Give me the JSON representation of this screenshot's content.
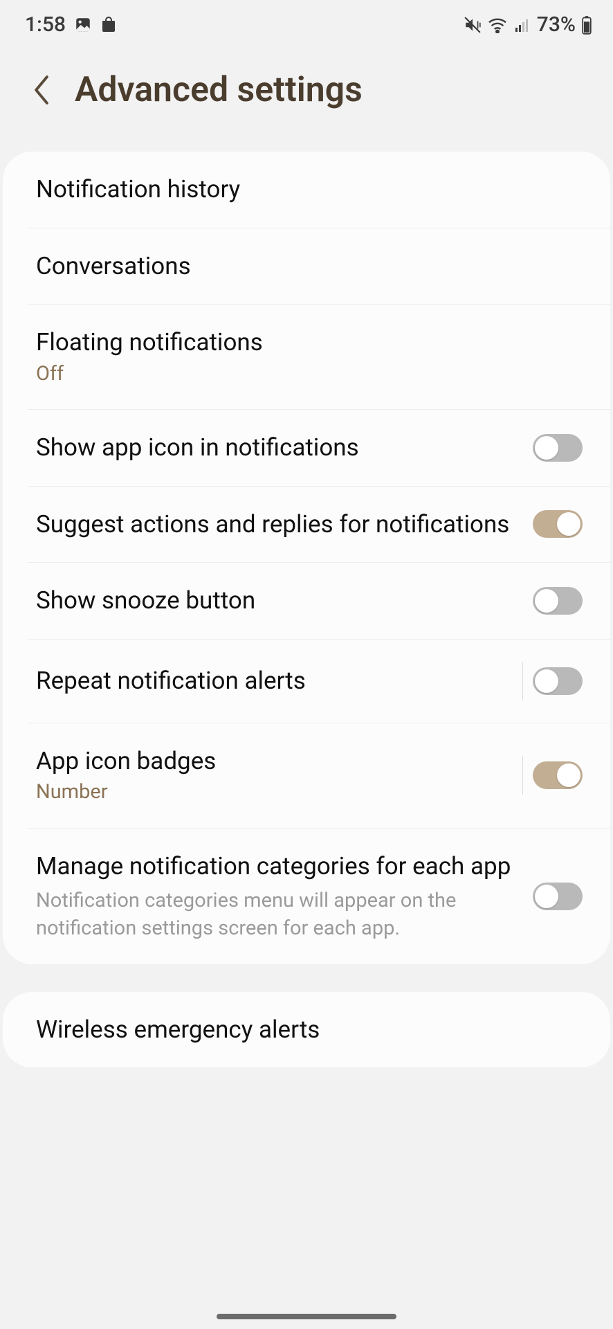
{
  "status": {
    "time": "1:58",
    "battery": "73%"
  },
  "header": {
    "title": "Advanced settings"
  },
  "group1": {
    "items": [
      {
        "title": "Notification history"
      },
      {
        "title": "Conversations"
      },
      {
        "title": "Floating notifications",
        "sub": "Off"
      },
      {
        "title": "Show app icon in notifications",
        "toggle": "off"
      },
      {
        "title": "Suggest actions and replies for notifications",
        "toggle": "on"
      },
      {
        "title": "Show snooze button",
        "toggle": "off"
      },
      {
        "title": "Repeat notification alerts",
        "toggle": "off",
        "divider": true
      },
      {
        "title": "App icon badges",
        "sub": "Number",
        "toggle": "on",
        "divider": true
      },
      {
        "title": "Manage notification categories for each app",
        "desc": "Notification categories menu will appear on the notification settings screen for each app.",
        "toggle": "off"
      }
    ]
  },
  "group2": {
    "items": [
      {
        "title": "Wireless emergency alerts"
      }
    ]
  }
}
